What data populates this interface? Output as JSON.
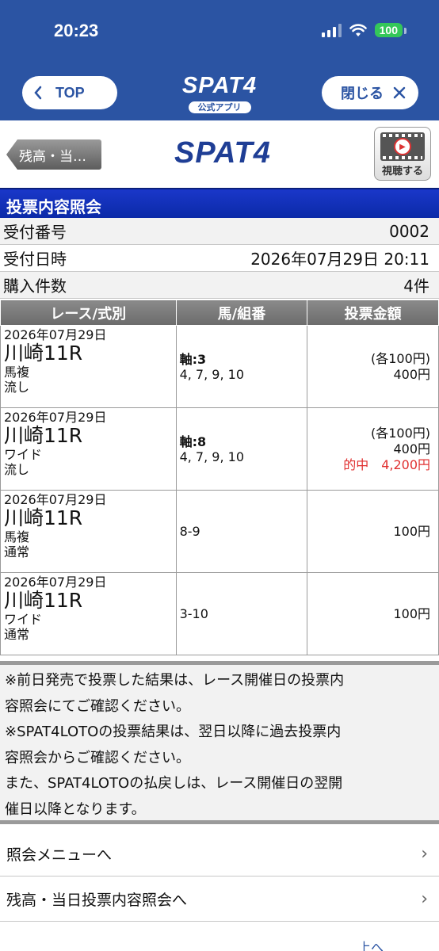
{
  "status": {
    "time": "20:23",
    "battery": "100"
  },
  "header": {
    "top_label": "TOP",
    "logo": "SPAT4",
    "logo_sub": "公式アプリ",
    "close_label": "閉じる"
  },
  "page": {
    "back_label": "残高・当…",
    "logo": "SPAT4",
    "watch_label": "視聴する"
  },
  "section_title": "投票内容照会",
  "info": [
    {
      "label": "受付番号",
      "value": "0002"
    },
    {
      "label": "受付日時",
      "value": "2026年07月29日 20:11"
    },
    {
      "label": "購入件数",
      "value": "4件"
    }
  ],
  "table": {
    "headers": [
      "レース/式別",
      "馬/組番",
      "投票金額"
    ],
    "rows": [
      {
        "date": "2026年07月29日",
        "race": "川崎11R",
        "type": "馬複",
        "method": "流し",
        "axis": "軸:3",
        "combo": "4, 7, 9, 10",
        "each": "(各100円)",
        "amount": "400円",
        "hit": ""
      },
      {
        "date": "2026年07月29日",
        "race": "川崎11R",
        "type": "ワイド",
        "method": "流し",
        "axis": "軸:8",
        "combo": "4, 7, 9, 10",
        "each": "(各100円)",
        "amount": "400円",
        "hit": "的中　4,200円"
      },
      {
        "date": "2026年07月29日",
        "race": "川崎11R",
        "type": "馬複",
        "method": "通常",
        "axis": "",
        "combo": "8-9",
        "each": "",
        "amount": "100円",
        "hit": ""
      },
      {
        "date": "2026年07月29日",
        "race": "川崎11R",
        "type": "ワイド",
        "method": "通常",
        "axis": "",
        "combo": "3-10",
        "each": "",
        "amount": "100円",
        "hit": ""
      }
    ]
  },
  "notes": [
    "※前日発売で投票した結果は、レース開催日の投票内",
    "容照会にてご確認ください。",
    "※SPAT4LOTOの投票結果は、翌日以降に過去投票内",
    "容照会からご確認ください。",
    "また、SPAT4LOTOの払戻しは、レース開催日の翌開",
    "催日以降となります。"
  ],
  "menu": [
    {
      "label": "照会メニューへ"
    },
    {
      "label": "残高・当日投票内容照会へ"
    }
  ],
  "bottom_link": "上へ",
  "colors": {
    "header_blue": "#2b54a3",
    "section_blue": "#0b2aa8",
    "hit_red": "#e03030"
  }
}
